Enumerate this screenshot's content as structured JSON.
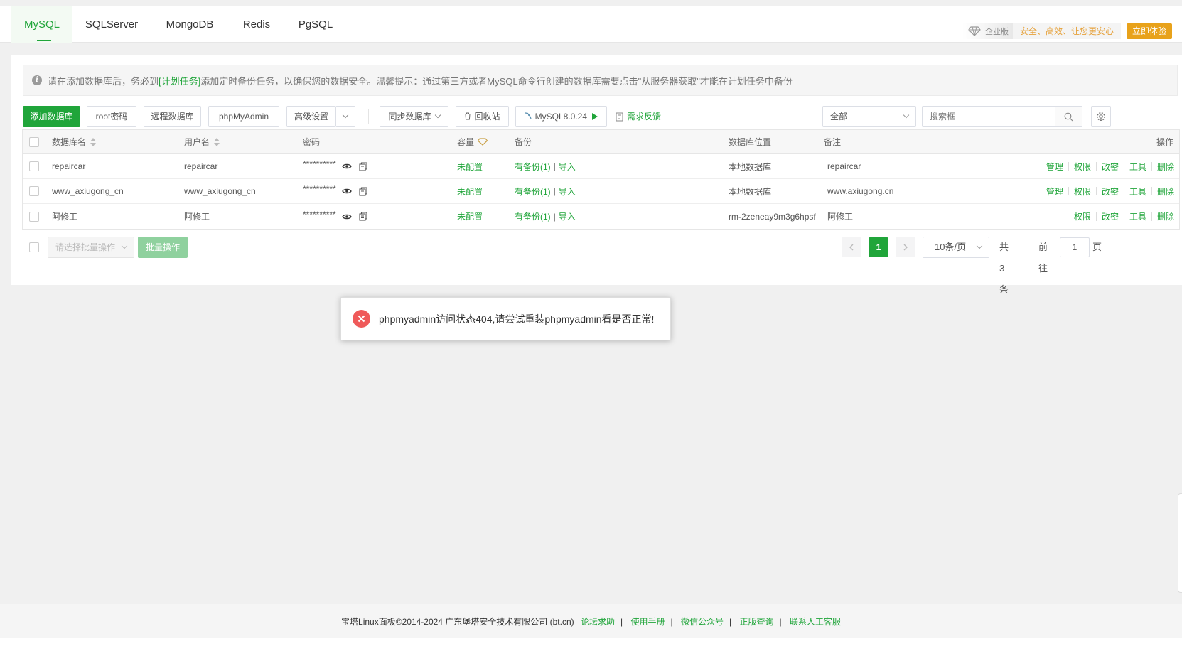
{
  "tabs": [
    {
      "label": "MySQL",
      "active": true
    },
    {
      "label": "SQLServer",
      "active": false
    },
    {
      "label": "MongoDB",
      "active": false
    },
    {
      "label": "Redis",
      "active": false
    },
    {
      "label": "PgSQL",
      "active": false
    }
  ],
  "promo": {
    "badge": "企业版",
    "slogan": "安全、高效、让您更安心",
    "cta": "立即体验"
  },
  "notice": {
    "prefix": "请在添加数据库后，务必到",
    "link": "[计划任务]",
    "suffix": "添加定时备份任务，以确保您的数据安全。温馨提示：通过第三方或者MySQL命令行创建的数据库需要点击\"从服务器获取\"才能在计划任务中备份"
  },
  "toolbar": {
    "add_db": "添加数据库",
    "root_pwd": "root密码",
    "remote_db": "远程数据库",
    "phpmyadmin": "phpMyAdmin",
    "advanced": "高级设置",
    "sync_db": "同步数据库",
    "recycle": "回收站",
    "mysql_version": "MySQL8.0.24",
    "feedback": "需求反馈",
    "filter_value": "全部",
    "search_placeholder": "搜索框"
  },
  "table": {
    "headers": {
      "name": "数据库名",
      "user": "用户名",
      "password": "密码",
      "capacity": "容量",
      "backup": "备份",
      "location": "数据库位置",
      "remark": "备注",
      "ops": "操作"
    },
    "rows": [
      {
        "name": "repaircar",
        "user": "repaircar",
        "password": "**********",
        "capacity": "未配置",
        "backup": "有备份(1)",
        "import": "导入",
        "location": "本地数据库",
        "remark": "repaircar",
        "ops": [
          "管理",
          "权限",
          "改密",
          "工具",
          "删除"
        ]
      },
      {
        "name": "www_axiugong_cn",
        "user": "www_axiugong_cn",
        "password": "**********",
        "capacity": "未配置",
        "backup": "有备份(1)",
        "import": "导入",
        "location": "本地数据库",
        "remark": "www.axiugong.cn",
        "ops": [
          "管理",
          "权限",
          "改密",
          "工具",
          "删除"
        ]
      },
      {
        "name": "阿修工",
        "user": "阿修工",
        "password": "**********",
        "capacity": "未配置",
        "backup": "有备份(1)",
        "import": "导入",
        "location": "rm-2zeneay9m3g6hpsf",
        "remark": "阿修工",
        "ops": [
          "权限",
          "改密",
          "工具",
          "删除"
        ]
      }
    ],
    "backup_sep": "|"
  },
  "batch": {
    "select_placeholder": "请选择批量操作",
    "button": "批量操作"
  },
  "pager": {
    "current": "1",
    "page_size": "10条/页",
    "total": "共 3 条",
    "goto": "前往",
    "goto_value": "1",
    "page_unit": "页"
  },
  "toast": {
    "message": "phpmyadmin访问状态404,请尝试重装phpmyadmin看是否正常!"
  },
  "footer": {
    "copyright": "宝塔Linux面板©2014-2024 广东堡塔安全技术有限公司 (bt.cn)",
    "links": [
      "论坛求助",
      "使用手册",
      "微信公众号",
      "正版查询",
      "联系人工客服"
    ],
    "sep": "|"
  },
  "colors": {
    "accent": "#20a53a",
    "error": "#ef5a5a",
    "promo": "#e8a21b"
  }
}
